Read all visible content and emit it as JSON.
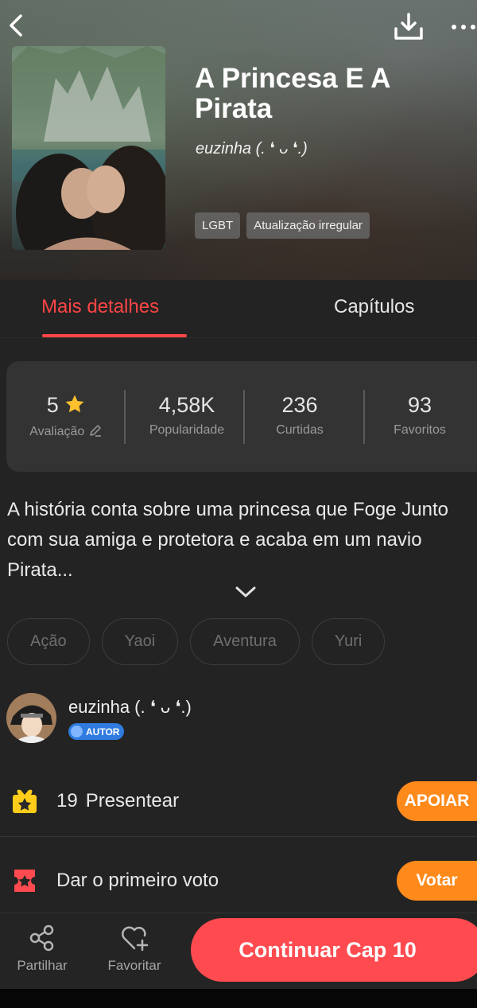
{
  "header": {
    "title": "A Princesa E A Pirata",
    "author": "euzinha (. ❛ ᴗ ❛.)",
    "tags": [
      "LGBT",
      "Atualização irregular"
    ],
    "icons": {
      "back": "back-arrow-icon",
      "download": "download-icon",
      "more": "more-dots-icon"
    }
  },
  "tabs": {
    "details": "Mais detalhes",
    "chapters": "Capítulos",
    "active": "details"
  },
  "stats": {
    "rating_value": "5",
    "rating_label": "Avaliação",
    "popularity_value": "4,58K",
    "popularity_label": "Popularidade",
    "likes_value": "236",
    "likes_label": "Curtidas",
    "favorites_value": "93",
    "favorites_label": "Favoritos"
  },
  "description": "A história conta sobre uma princesa que Foge Junto com sua amiga e protetora e acaba em um navio Pirata...",
  "genres": [
    "Ação",
    "Yaoi",
    "Aventura",
    "Yuri"
  ],
  "author_card": {
    "name": "euzinha (. ❛ ᴗ ❛.)",
    "badge": "AUTOR"
  },
  "gift": {
    "count": "19",
    "label": "Presentear",
    "button": "APOIAR"
  },
  "vote": {
    "label": "Dar o primeiro voto",
    "button": "Votar"
  },
  "bottom_bar": {
    "share": "Partilhar",
    "favorite": "Favoritar",
    "continue": "Continuar Cap 10"
  },
  "colors": {
    "accent": "#ff4545",
    "orange": "#ff8a1c",
    "continue": "#ff4b50",
    "badge": "#2f7be0"
  }
}
